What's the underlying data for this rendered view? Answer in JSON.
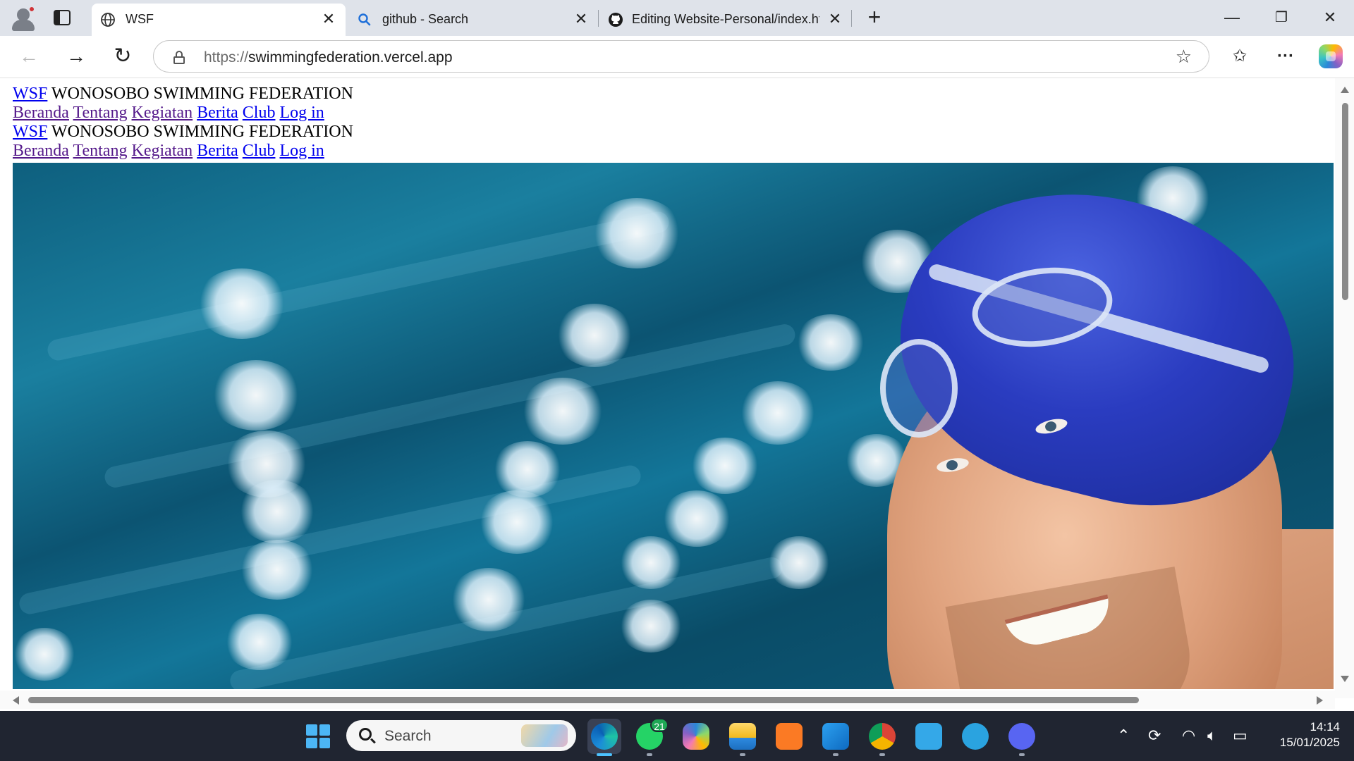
{
  "browser": {
    "tabs": [
      {
        "title": "WSF",
        "active": true,
        "favicon": "globe-icon"
      },
      {
        "title": "github - Search",
        "active": false,
        "favicon": "search-icon"
      },
      {
        "title": "Editing Website-Personal/index.ht",
        "active": false,
        "favicon": "github-icon"
      }
    ],
    "url_scheme": "https://",
    "url_host": "swimmingfederation.vercel.app"
  },
  "page": {
    "header_rows": [
      {
        "brand_link": "WSF",
        "brand_text": " WONOSOBO SWIMMING FEDERATION",
        "nav": [
          "Beranda",
          "Tentang",
          "Kegiatan",
          "Berita",
          "Club",
          "Log in"
        ]
      },
      {
        "brand_link": "WSF",
        "brand_text": " WONOSOBO SWIMMING FEDERATION",
        "nav": [
          "Beranda",
          "Tentang",
          "Kegiatan",
          "Berita",
          "Club",
          "Log in"
        ]
      }
    ],
    "hero_image": "swimmer-photo"
  },
  "taskbar": {
    "search_placeholder": "Search",
    "whatsapp_badge": "21",
    "time": "14:14",
    "date": "15/01/2025"
  },
  "colors": {
    "link": "#0000ee",
    "visited_link": "#551a8b",
    "taskbar_bg": "#202531",
    "tabstrip_bg": "#dfe3ea"
  }
}
